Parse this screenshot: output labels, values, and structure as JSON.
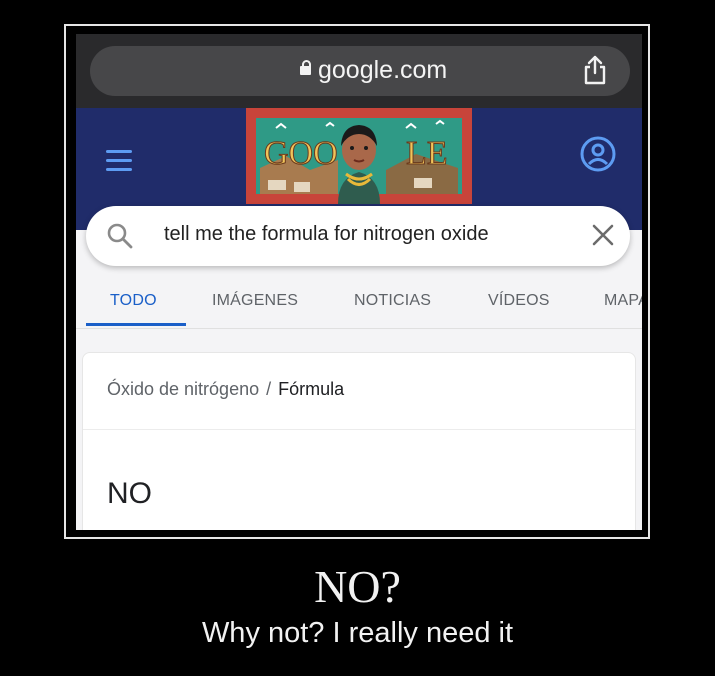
{
  "browser": {
    "url": "google.com"
  },
  "doodle": {
    "text": "GOOGLE"
  },
  "search": {
    "query": "tell me the formula for nitrogen oxide"
  },
  "tabs": [
    {
      "label": "TODO",
      "active": true
    },
    {
      "label": "IMÁGENES",
      "active": false
    },
    {
      "label": "NOTICIAS",
      "active": false
    },
    {
      "label": "VÍDEOS",
      "active": false
    },
    {
      "label": "MAPAS",
      "active": false
    }
  ],
  "result": {
    "breadcrumb_parent": "Óxido de nitrógeno",
    "breadcrumb_separator": "/",
    "breadcrumb_current": "Fórmula",
    "answer": "NO"
  },
  "caption": {
    "title": "NO?",
    "subtitle": "Why not? I really need it"
  },
  "colors": {
    "accent": "#1a5fc8",
    "header_bg": "#202c6a",
    "icon_blue": "#5d9cf2"
  }
}
